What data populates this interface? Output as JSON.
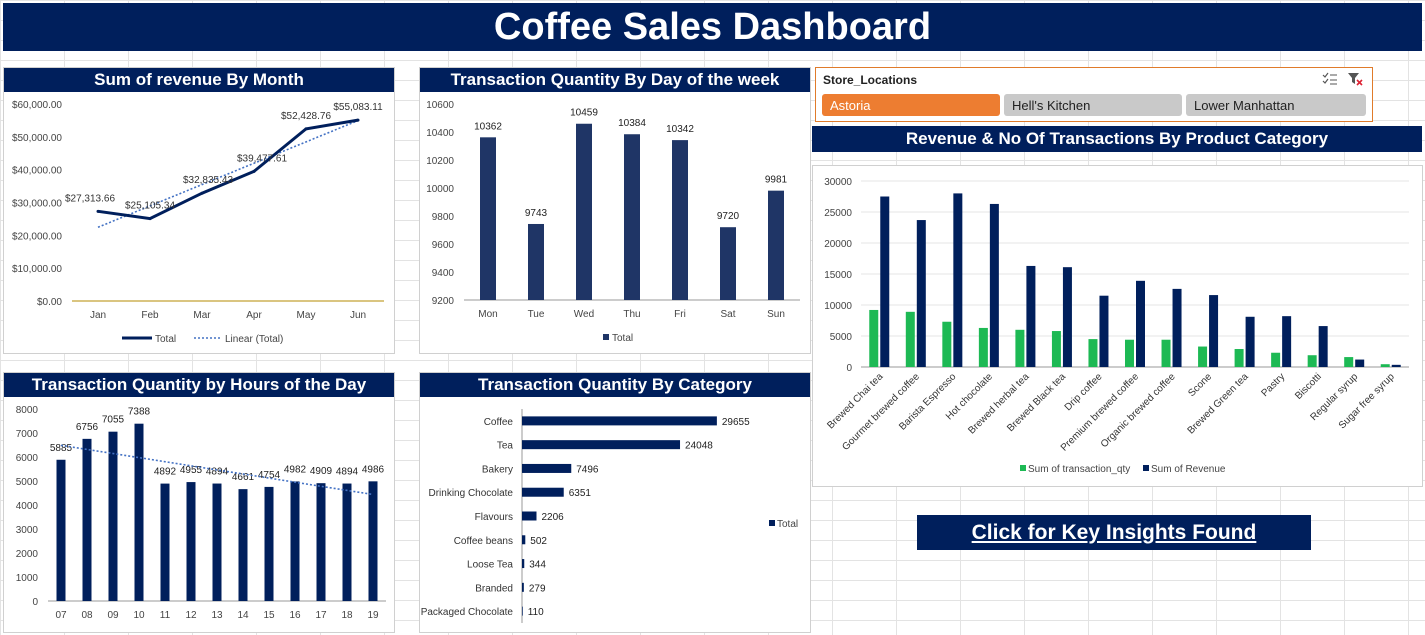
{
  "header": {
    "title": "Coffee Sales Dashboard"
  },
  "colors": {
    "navy": "#001f5c",
    "bar": "#1f3566",
    "green": "#1db954",
    "orange": "#ed7d31",
    "trend": "#4472c4"
  },
  "slicer": {
    "title": "Store_Locations",
    "options": [
      {
        "label": "Astoria",
        "selected": true
      },
      {
        "label": "Hell's Kitchen",
        "selected": false
      },
      {
        "label": "Lower Manhattan",
        "selected": false
      }
    ],
    "icons": [
      "multi-select-icon",
      "clear-filter-icon"
    ]
  },
  "insights_button": {
    "label": "Click for Key Insights Found"
  },
  "chart_data": [
    {
      "id": "revenue_month",
      "type": "line",
      "title": "Sum of revenue By Month",
      "categories": [
        "Jan",
        "Feb",
        "Mar",
        "Apr",
        "May",
        "Jun"
      ],
      "series": [
        {
          "name": "Total",
          "values": [
            27313.66,
            25105.34,
            32835.43,
            39477.61,
            52428.76,
            55083.11
          ]
        }
      ],
      "data_labels": [
        "$27,313.66",
        "$25,105.34",
        "$32,835.43",
        "$39,477.61",
        "$52,428.76",
        "$55,083.11"
      ],
      "trendline": {
        "name": "Linear (Total)",
        "type": "linear"
      },
      "ylim": [
        0,
        60000
      ],
      "yticks": [
        0,
        10000,
        20000,
        30000,
        40000,
        50000,
        60000
      ],
      "ytick_labels": [
        "$0.00",
        "$10,000.00",
        "$20,000.00",
        "$30,000.00",
        "$40,000.00",
        "$50,000.00",
        "$60,000.00"
      ],
      "legend": "bottom"
    },
    {
      "id": "qty_weekday",
      "type": "bar",
      "title": "Transaction Quantity By Day of the week",
      "categories": [
        "Mon",
        "Tue",
        "Wed",
        "Thu",
        "Fri",
        "Sat",
        "Sun"
      ],
      "series": [
        {
          "name": "Total",
          "values": [
            10362,
            9743,
            10459,
            10384,
            10342,
            9720,
            9981
          ]
        }
      ],
      "ylim": [
        9200,
        10600
      ],
      "yticks": [
        9200,
        9400,
        9600,
        9800,
        10000,
        10200,
        10400,
        10600
      ],
      "legend": "bottom"
    },
    {
      "id": "qty_hour",
      "type": "bar",
      "title": "Transaction Quantity by Hours of the Day",
      "categories": [
        "07",
        "08",
        "09",
        "10",
        "11",
        "12",
        "13",
        "14",
        "15",
        "16",
        "17",
        "18",
        "19"
      ],
      "series": [
        {
          "name": "Total",
          "values": [
            5885,
            6756,
            7055,
            7388,
            4892,
            4955,
            4894,
            4661,
            4754,
            4982,
            4909,
            4894,
            4986
          ]
        }
      ],
      "trendline": {
        "type": "linear"
      },
      "ylim": [
        0,
        8000
      ],
      "yticks": [
        0,
        1000,
        2000,
        3000,
        4000,
        5000,
        6000,
        7000,
        8000
      ]
    },
    {
      "id": "qty_category",
      "type": "bar",
      "orientation": "horizontal",
      "title": "Transaction Quantity By Category",
      "categories": [
        "Coffee",
        "Tea",
        "Bakery",
        "Drinking Chocolate",
        "Flavours",
        "Coffee beans",
        "Loose Tea",
        "Branded",
        "Packaged Chocolate"
      ],
      "series": [
        {
          "name": "Total",
          "values": [
            29655,
            24048,
            7496,
            6351,
            2206,
            502,
            344,
            279,
            110
          ]
        }
      ],
      "xlim": [
        0,
        35000
      ],
      "legend": "right"
    },
    {
      "id": "product_category",
      "type": "bar",
      "title": "Revenue & No Of Transactions By Product Category",
      "categories": [
        "Brewed Chai tea",
        "Gourmet brewed coffee",
        "Barista Espresso",
        "Hot chocolate",
        "Brewed herbal tea",
        "Brewed Black tea",
        "Drip coffee",
        "Premium brewed coffee",
        "Organic brewed coffee",
        "Scone",
        "Brewed Green tea",
        "Pastry",
        "Biscotti",
        "Regular syrup",
        "Sugar free syrup"
      ],
      "series": [
        {
          "name": "Sum of transaction_qty",
          "values": [
            9200,
            8900,
            7300,
            6300,
            6000,
            5800,
            4500,
            4400,
            4400,
            3300,
            2900,
            2300,
            1900,
            1600,
            450
          ]
        },
        {
          "name": "Sum of Revenue",
          "values": [
            27500,
            23700,
            28000,
            26300,
            16300,
            16100,
            11500,
            13900,
            12600,
            11600,
            8100,
            8200,
            6600,
            1200,
            350
          ]
        }
      ],
      "ylim": [
        0,
        30000
      ],
      "yticks": [
        0,
        5000,
        10000,
        15000,
        20000,
        25000,
        30000
      ],
      "legend": "bottom"
    }
  ]
}
